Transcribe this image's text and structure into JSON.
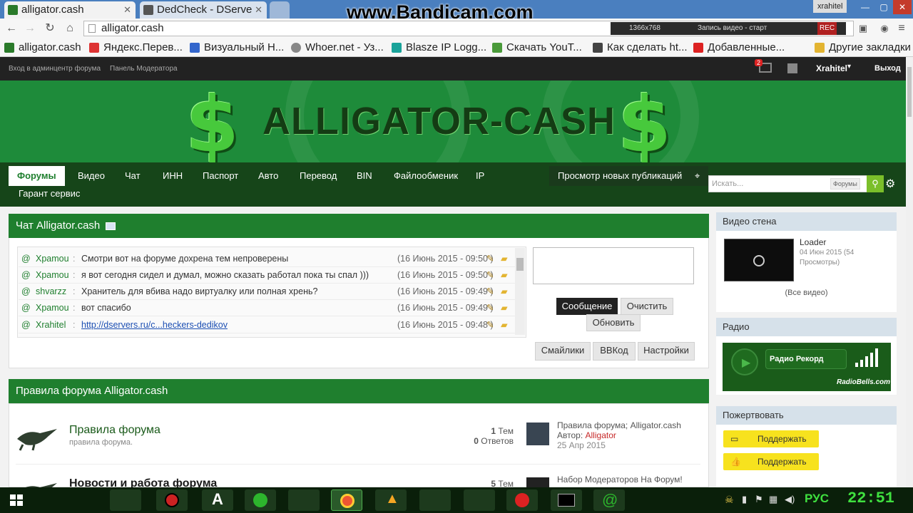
{
  "browser": {
    "tabs": [
      {
        "title": "alligator.cash",
        "favicon": "alligator-favicon"
      },
      {
        "title": "DedCheck - DServe",
        "favicon": "dedcheck-favicon"
      }
    ],
    "url": "alligator.cash",
    "os_user": "xrahitel",
    "watermark": "www.Bandicam.com",
    "recorder": {
      "resolution": "1366x768",
      "status": "Запись видео - старт",
      "rec": "REC"
    },
    "bookmarks": [
      "alligator.cash",
      "Яндекс.Перев...",
      "Визуальный Н...",
      "Whoer.net - Уз...",
      "Blasze IP Logg...",
      "Скачать YouT...",
      "Как сделать ht...",
      "Добавленные...",
      "Другие закладки"
    ]
  },
  "adminbar": {
    "links": [
      "Вход в админцентр форума",
      "Панель Модератора"
    ],
    "notification_count": "2",
    "username": "Xrahitel",
    "logout": "Выход"
  },
  "banner": {
    "logo_text": "ALLIGATOR-CASH",
    "symbol": "$"
  },
  "mainnav": {
    "tabs": [
      "Форумы",
      "Видео",
      "Чат",
      "ИНН",
      "Паспорт",
      "Авто",
      "Перевод",
      "BIN",
      "Файлообменик",
      "IP"
    ],
    "tabs_row2": [
      "Гарант сервис"
    ],
    "new_posts": "Просмотр новых публикаций",
    "search_placeholder": "Искать...",
    "search_scope": "Форумы"
  },
  "chat": {
    "title": "Чат Alligator.cash",
    "messages": [
      {
        "user": "Храmou",
        "text": "Смотри вот на форуме дохрена тем непроверены",
        "time": "(16 Июнь 2015 - 09:50 )"
      },
      {
        "user": "Храmou",
        "text": "я вот сегодня сидел и думал, можно сказать работал пока ты спал )))",
        "time": "(16 Июнь 2015 - 09:50 )"
      },
      {
        "user": "shvarzz",
        "text": "Хранитель для вбива надо виртуалку или полная хрень?",
        "time": "(16 Июнь 2015 - 09:49 )"
      },
      {
        "user": "Храmou",
        "text": "вот спасибо",
        "time": "(16 Июнь 2015 - 09:49 )"
      },
      {
        "user": "Xrahitel",
        "text": "http://dservers.ru/c...heckers-dedikov",
        "time": "(16 Июнь 2015 - 09:48 )",
        "link": true
      }
    ],
    "send": "Сообщение",
    "clear": "Очистить",
    "refresh": "Обновить",
    "smilies": "Смайлики",
    "bbcode": "BBКод",
    "settings": "Настройки"
  },
  "forum_section": {
    "title": "Правила форума Alligator.cash",
    "rows": [
      {
        "name": "Правила форума",
        "desc": "правила форума.",
        "topics_n": "1",
        "topics_l": "Тем",
        "replies_n": "0",
        "replies_l": "Ответов",
        "last_title": "Правила форума; Alligator.cash",
        "last_author_label": "Автор:",
        "last_author": "Alligator",
        "last_date": "25 Апр 2015"
      },
      {
        "name": "Новости и работа форума",
        "topics_n": "5",
        "topics_l": "Тем",
        "last_title": "Набор Модераторов На Форум!"
      }
    ]
  },
  "sidebar": {
    "video_wall": {
      "title": "Видео стена",
      "item_title": "Loader",
      "item_meta": "04 Июн 2015 (54 Просмотры)",
      "all": "(Все видео)"
    },
    "radio": {
      "title": "Радио",
      "station": "Радио Рекорд",
      "brand": "RadioBells.com"
    },
    "donate": {
      "title": "Пожертвовать",
      "button": "Поддержать"
    }
  },
  "taskbar": {
    "lang": "РУС",
    "clock": "22:51"
  },
  "colors": {
    "forum_green": "#1f7f2e",
    "dark_green": "#164519",
    "banner_green": "#1e8b3a",
    "link_red": "#c62828"
  }
}
